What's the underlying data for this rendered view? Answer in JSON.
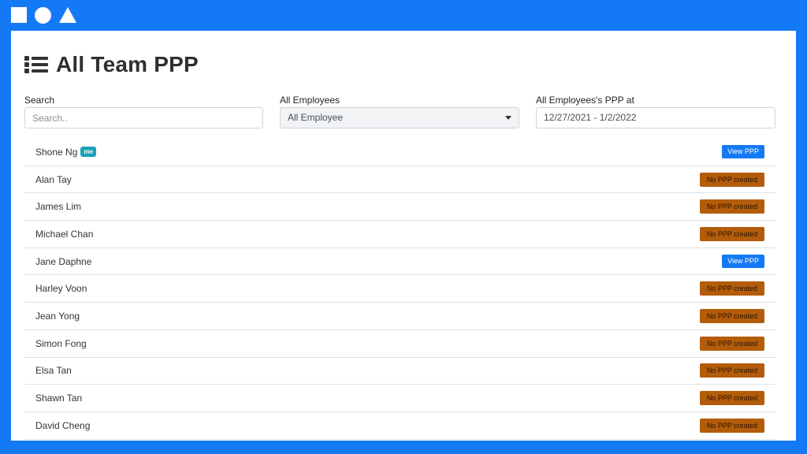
{
  "page": {
    "title": "All Team PPP"
  },
  "filters": {
    "search_label": "Search",
    "search_placeholder": "Search..",
    "employee_label": "All Employees",
    "employee_value": "All Employee",
    "date_label": "All Employees's PPP at",
    "date_value": "12/27/2021 - 1/2/2022"
  },
  "me_badge": "me",
  "employees": [
    {
      "name": "Shone Ng",
      "me": true,
      "action": "View PPP",
      "status": "view"
    },
    {
      "name": "Alan Tay",
      "action": "No PPP created",
      "status": "none"
    },
    {
      "name": "James Lim",
      "action": "No PPP created",
      "status": "none"
    },
    {
      "name": "Michael Chan",
      "action": "No PPP created",
      "status": "none"
    },
    {
      "name": "Jane Daphne",
      "action": "View PPP",
      "status": "view"
    },
    {
      "name": "Harley Voon",
      "action": "No PPP created",
      "status": "none"
    },
    {
      "name": "Jean Yong",
      "action": "No PPP created",
      "status": "none"
    },
    {
      "name": "Simon Fong",
      "action": "No PPP created",
      "status": "none"
    },
    {
      "name": "Elsa Tan",
      "action": "No PPP created",
      "status": "none"
    },
    {
      "name": "Shawn Tan",
      "action": "No PPP created",
      "status": "none"
    },
    {
      "name": "David Cheng",
      "action": "No PPP created",
      "status": "none"
    }
  ],
  "colors": {
    "frame": "#1479f5",
    "view_button": "#1479f5",
    "no_ppp_badge": "#b35c0a",
    "me_badge": "#17a2b8"
  }
}
